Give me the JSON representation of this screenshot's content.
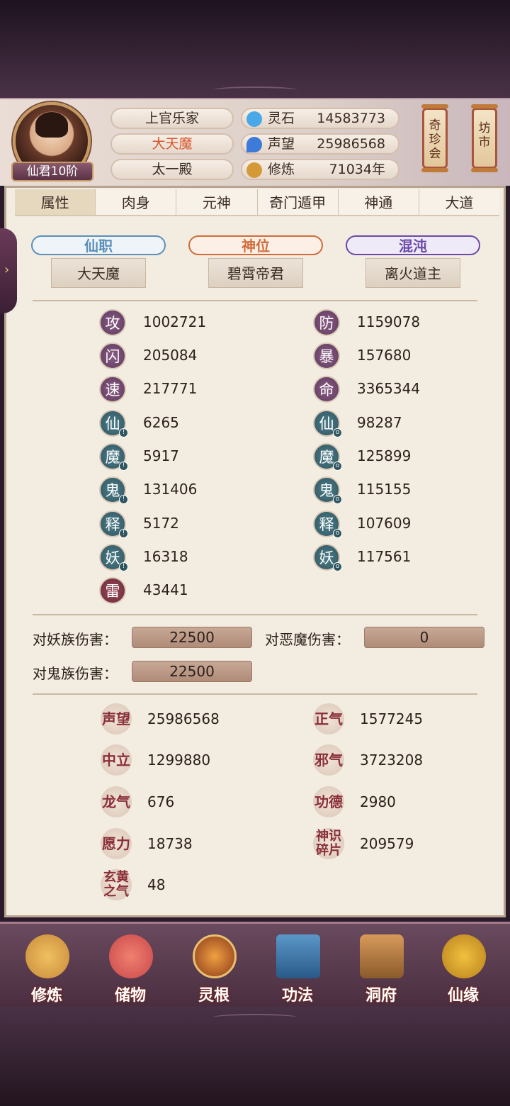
{
  "header": {
    "rank": "仙君10阶",
    "names": [
      "上官乐家",
      "大天魔",
      "太一殿"
    ],
    "resources": [
      {
        "icon": "spirit-stone-icon",
        "label": "灵石",
        "value": "14583773",
        "color": "#4aa8e8"
      },
      {
        "icon": "reputation-icon",
        "label": "声望",
        "value": "25986568",
        "color": "#3e7ad8"
      },
      {
        "icon": "cultivation-icon",
        "label": "修炼",
        "value": "71034年",
        "color": "#d49a3a"
      }
    ],
    "scrolls": [
      "奇\n珍\n会",
      "坊\n市"
    ]
  },
  "tabs": [
    "属性",
    "肉身",
    "元神",
    "奇门遁甲",
    "神通",
    "大道"
  ],
  "titles": [
    {
      "badge": "仙职",
      "value": "大天魔",
      "color": "#5b8fb8"
    },
    {
      "badge": "神位",
      "value": "碧霄帝君",
      "color": "#d26b3a"
    },
    {
      "badge": "混沌",
      "value": "离火道主",
      "color": "#6a4aa8"
    }
  ],
  "stats_left": [
    {
      "char": "攻",
      "value": "1002721",
      "style": "purple"
    },
    {
      "char": "闪",
      "value": "205084",
      "style": "purple"
    },
    {
      "char": "速",
      "value": "217771",
      "style": "purple"
    },
    {
      "char": "仙",
      "value": "6265",
      "style": "teal"
    },
    {
      "char": "魔",
      "value": "5917",
      "style": "teal"
    },
    {
      "char": "鬼",
      "value": "131406",
      "style": "teal"
    },
    {
      "char": "释",
      "value": "5172",
      "style": "teal"
    },
    {
      "char": "妖",
      "value": "16318",
      "style": "teal"
    },
    {
      "char": "雷",
      "value": "43441",
      "style": "red"
    }
  ],
  "stats_right": [
    {
      "char": "防",
      "value": "1159078",
      "style": "purple"
    },
    {
      "char": "暴",
      "value": "157680",
      "style": "purple"
    },
    {
      "char": "命",
      "value": "3365344",
      "style": "purple"
    },
    {
      "char": "仙",
      "value": "98287",
      "style": "teal"
    },
    {
      "char": "魔",
      "value": "125899",
      "style": "teal"
    },
    {
      "char": "鬼",
      "value": "115155",
      "style": "teal"
    },
    {
      "char": "释",
      "value": "107609",
      "style": "teal"
    },
    {
      "char": "妖",
      "value": "117561",
      "style": "teal"
    }
  ],
  "damage": [
    {
      "label": "对妖族伤害：",
      "value": "22500"
    },
    {
      "label": "对恶魔伤害：",
      "value": "0"
    },
    {
      "label": "对鬼族伤害：",
      "value": "22500"
    }
  ],
  "misc_left": [
    {
      "tag": "声望",
      "value": "25986568"
    },
    {
      "tag": "中立",
      "value": "1299880"
    },
    {
      "tag": "龙气",
      "value": "676"
    },
    {
      "tag": "愿力",
      "value": "18738"
    },
    {
      "tag": "玄黄\n之气",
      "value": "48"
    }
  ],
  "misc_right": [
    {
      "tag": "正气",
      "value": "1577245"
    },
    {
      "tag": "邪气",
      "value": "3723208"
    },
    {
      "tag": "功德",
      "value": "2980"
    },
    {
      "tag": "神识\n碎片",
      "value": "209579"
    }
  ],
  "bottom_nav": [
    {
      "label": "修炼",
      "icon": "meditating-monk-icon",
      "color": "#c88a3a"
    },
    {
      "label": "储物",
      "icon": "treasure-bag-icon",
      "color": "#c8484a"
    },
    {
      "label": "灵根",
      "icon": "spirit-root-icon",
      "color": "#d8782a"
    },
    {
      "label": "功法",
      "icon": "scripture-book-icon",
      "color": "#3a78a8"
    },
    {
      "label": "洞府",
      "icon": "cave-mansion-icon",
      "color": "#a86a3a"
    },
    {
      "label": "仙缘",
      "icon": "gourd-icon",
      "color": "#c8902a"
    }
  ]
}
